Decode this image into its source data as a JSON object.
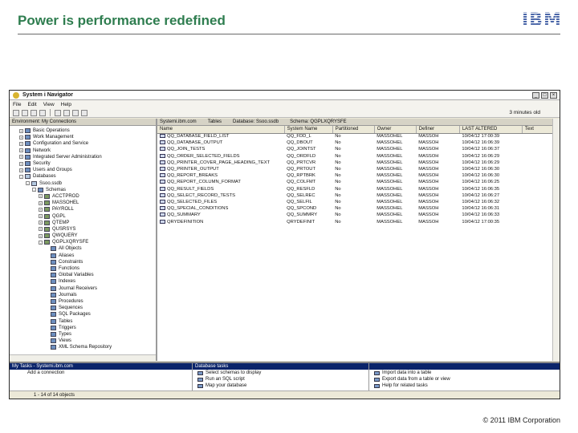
{
  "slide": {
    "title": "Power is performance redefined",
    "logo": "IBM",
    "copyright": "© 2011 IBM Corporation"
  },
  "window": {
    "title": "System i Navigator",
    "menus": [
      "File",
      "Edit",
      "View",
      "Help"
    ],
    "toolbar_right": "3 minutes old",
    "left_header": "Environment: My Connections",
    "breadcrumb": [
      "Systemi.ibm.com",
      "Tables",
      "Database: Ssoo.ssdb",
      "Schema: QGPLXQRYSFE"
    ]
  },
  "tree": [
    {
      "label": "Basic Operations",
      "level": 1,
      "exp": "+",
      "icon": "folder"
    },
    {
      "label": "Work Management",
      "level": 1,
      "exp": "+",
      "icon": "folder"
    },
    {
      "label": "Configuration and Service",
      "level": 1,
      "exp": "+",
      "icon": "folder"
    },
    {
      "label": "Network",
      "level": 1,
      "exp": "+",
      "icon": "folder"
    },
    {
      "label": "Integrated Server Administration",
      "level": 1,
      "exp": "+",
      "icon": "folder"
    },
    {
      "label": "Security",
      "level": 1,
      "exp": "+",
      "icon": "folder"
    },
    {
      "label": "Users and Groups",
      "level": 1,
      "exp": "+",
      "icon": "folder"
    },
    {
      "label": "Databases",
      "level": 1,
      "exp": "-",
      "icon": "db"
    },
    {
      "label": "Ssoo.ssdb",
      "level": 2,
      "exp": "-",
      "icon": "db"
    },
    {
      "label": "Schemas",
      "level": 3,
      "exp": "-",
      "icon": "folder"
    },
    {
      "label": "ACCTPROD",
      "level": 4,
      "exp": "+",
      "icon": "sch"
    },
    {
      "label": "MASSOHEL",
      "level": 4,
      "exp": "+",
      "icon": "sch"
    },
    {
      "label": "PAYROLL",
      "level": 4,
      "exp": "+",
      "icon": "sch"
    },
    {
      "label": "QGPL",
      "level": 4,
      "exp": "+",
      "icon": "sch"
    },
    {
      "label": "QTEMP",
      "level": 4,
      "exp": "+",
      "icon": "sch"
    },
    {
      "label": "QUSRSYS",
      "level": 4,
      "exp": "+",
      "icon": "sch"
    },
    {
      "label": "QWQUERY",
      "level": 4,
      "exp": "+",
      "icon": "sch"
    },
    {
      "label": "QGPLXQRYSFE",
      "level": 4,
      "exp": "-",
      "icon": "sch"
    },
    {
      "label": "All Objects",
      "level": 5,
      "exp": "",
      "icon": "folder"
    },
    {
      "label": "Aliases",
      "level": 5,
      "exp": "",
      "icon": "folder"
    },
    {
      "label": "Constraints",
      "level": 5,
      "exp": "",
      "icon": "folder"
    },
    {
      "label": "Functions",
      "level": 5,
      "exp": "",
      "icon": "folder"
    },
    {
      "label": "Global Variables",
      "level": 5,
      "exp": "",
      "icon": "folder"
    },
    {
      "label": "Indexes",
      "level": 5,
      "exp": "",
      "icon": "folder"
    },
    {
      "label": "Journal Receivers",
      "level": 5,
      "exp": "",
      "icon": "folder"
    },
    {
      "label": "Journals",
      "level": 5,
      "exp": "",
      "icon": "folder"
    },
    {
      "label": "Procedures",
      "level": 5,
      "exp": "",
      "icon": "folder"
    },
    {
      "label": "Sequences",
      "level": 5,
      "exp": "",
      "icon": "folder"
    },
    {
      "label": "SQL Packages",
      "level": 5,
      "exp": "",
      "icon": "folder"
    },
    {
      "label": "Tables",
      "level": 5,
      "exp": "",
      "icon": "folder"
    },
    {
      "label": "Triggers",
      "level": 5,
      "exp": "",
      "icon": "folder"
    },
    {
      "label": "Types",
      "level": 5,
      "exp": "",
      "icon": "folder"
    },
    {
      "label": "Views",
      "level": 5,
      "exp": "",
      "icon": "folder"
    },
    {
      "label": "XML Schema Repository",
      "level": 5,
      "exp": "",
      "icon": "folder"
    }
  ],
  "table": {
    "columns": [
      "Name",
      "System Name",
      "Partitioned",
      "Owner",
      "Definer",
      "LAST ALTERED",
      "Text"
    ],
    "rows": [
      [
        "QQ_DATABASE_FIELD_LIST",
        "QQ_FDD_L",
        "No",
        "MASSOHEL",
        "MASSOH",
        "10/04/12 17:00:39",
        ""
      ],
      [
        "QQ_DATABASE_OUTPUT",
        "QQ_DBOUT",
        "No",
        "MASSOHEL",
        "MASSOH",
        "10/04/12 16:06:39",
        ""
      ],
      [
        "QQ_JOIN_TESTS",
        "QQ_JOINTST",
        "No",
        "MASSOHEL",
        "MASSOH",
        "10/04/12 16:06:37",
        ""
      ],
      [
        "QQ_ORDER_SELECTED_FIELDS",
        "QQ_ORDFLD",
        "No",
        "MASSOHEL",
        "MASSOH",
        "10/04/12 16:06:29",
        ""
      ],
      [
        "QQ_PRINTER_COVER_PAGE_HEADING_TEXT",
        "QQ_PRTCVR",
        "No",
        "MASSOHEL",
        "MASSOH",
        "10/04/12 16:06:29",
        ""
      ],
      [
        "QQ_PRINTER_OUTPUT",
        "QQ_PRTOUT",
        "No",
        "MASSOHEL",
        "MASSOH",
        "10/04/12 16:06:30",
        ""
      ],
      [
        "QQ_REPORT_BREAKS",
        "QQ_RPTBRK",
        "No",
        "MASSOHEL",
        "MASSOH",
        "10/04/12 16:06:30",
        ""
      ],
      [
        "QQ_REPORT_COLUMN_FORMAT",
        "QQ_COLFMT",
        "No",
        "MASSOHEL",
        "MASSOH",
        "10/04/12 16:06:25",
        ""
      ],
      [
        "QQ_RESULT_FIELDS",
        "QQ_RESFLD",
        "No",
        "MASSOHEL",
        "MASSOH",
        "10/04/12 16:06:35",
        ""
      ],
      [
        "QQ_SELECT_RECORD_TESTS",
        "QQ_SELREC",
        "No",
        "MASSOHEL",
        "MASSOH",
        "10/04/12 16:06:27",
        ""
      ],
      [
        "QQ_SELECTED_FILES",
        "QQ_SELFIL",
        "No",
        "MASSOHEL",
        "MASSOH",
        "10/04/12 16:06:32",
        ""
      ],
      [
        "QQ_SPECIAL_CONDITIONS",
        "QQ_SPCOND",
        "No",
        "MASSOHEL",
        "MASSOH",
        "10/04/12 16:06:31",
        ""
      ],
      [
        "QQ_SUMMARY",
        "QQ_SUMMRY",
        "No",
        "MASSOHEL",
        "MASSOH",
        "10/04/12 16:06:33",
        ""
      ],
      [
        "QRYDEFINITION",
        "QRYDEFINIT",
        "No",
        "MASSOHEL",
        "MASSOH",
        "10/04/12 17:00:35",
        ""
      ]
    ]
  },
  "bottom": {
    "left_head": "My Tasks - Systemi.ibm.com",
    "left_line": "Add a connection",
    "mid_head": "Database tasks",
    "mid_tasks": [
      "Select schemas to display",
      "Run an SQL script",
      "Map your database"
    ],
    "right_tasks": [
      "Import data into a table",
      "Export data from a table or view",
      "Help for related tasks"
    ]
  },
  "status": "1 - 14 of 14 objects"
}
